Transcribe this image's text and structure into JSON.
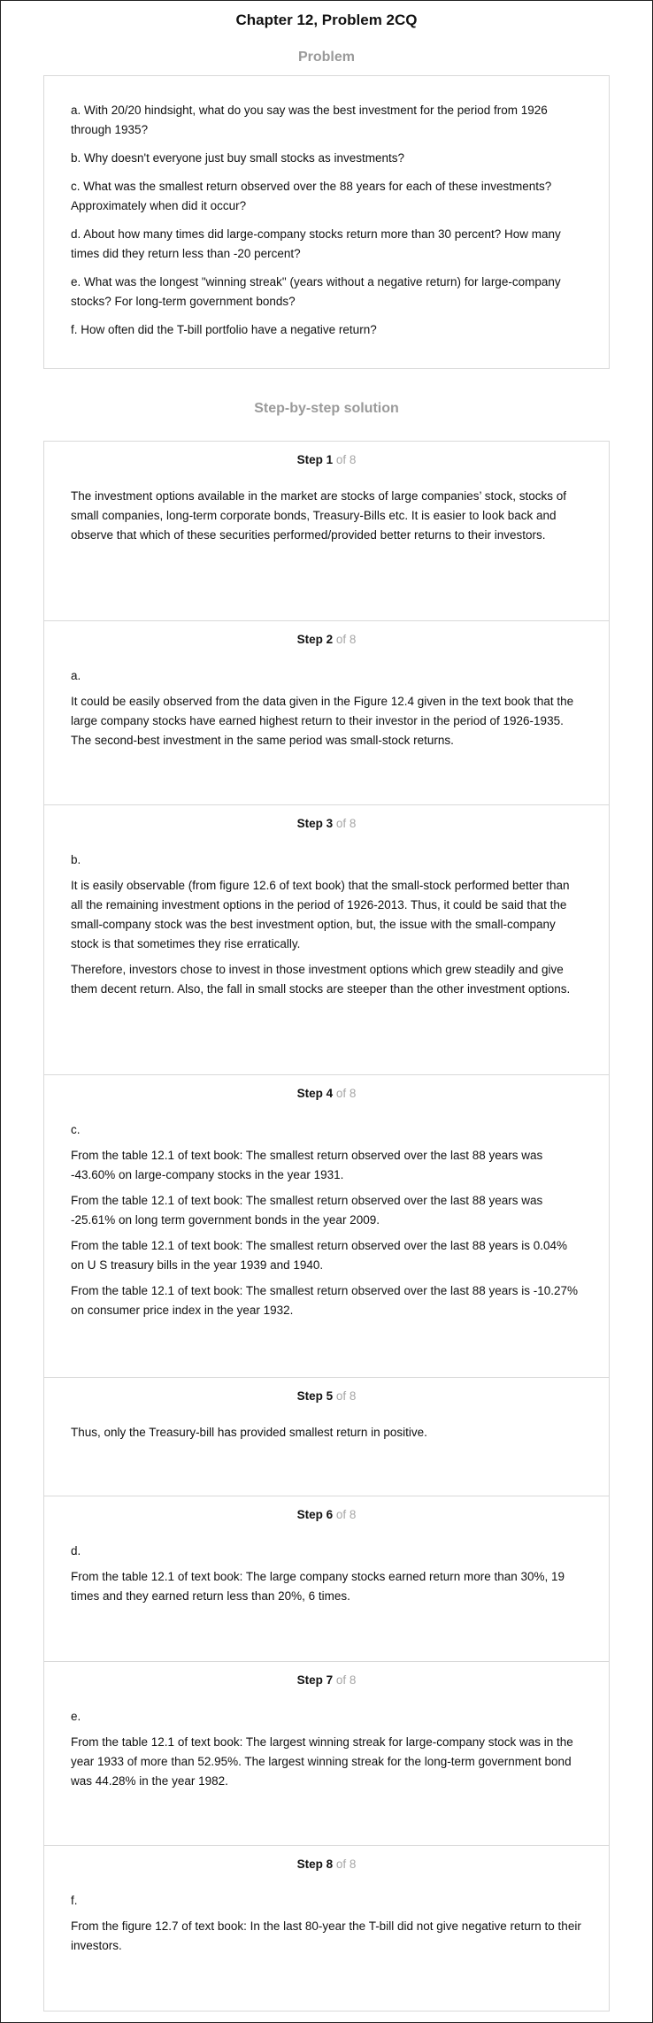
{
  "chapter_title": "Chapter 12, Problem 2CQ",
  "problem": {
    "heading": "Problem",
    "items": [
      "a. With 20/20 hindsight, what do you say was the best investment for the period from 1926 through 1935?",
      "b. Why doesn't everyone just buy small stocks as investments?",
      "c. What was the smallest return observed over the 88 years for each of these investments? Approximately when did it occur?",
      "d. About how many times did large-company stocks return more than 30 percent? How many times did they return less than -20 percent?",
      "e. What was the longest \"winning streak\" (years without a negative return) for large-company stocks? For long-term government bonds?",
      "f. How often did the T-bill portfolio have a negative return?"
    ]
  },
  "solution": {
    "heading": "Step-by-step solution",
    "step_word": "Step",
    "of_prefix": "of",
    "total": "8",
    "steps": [
      {
        "number": "1",
        "paragraphs": [
          "The investment options available in the market are stocks of large companies’ stock, stocks of small companies, long-term corporate bonds, Treasury-Bills etc. It is easier to look back and observe that which of these securities performed/provided better returns to their investors."
        ]
      },
      {
        "number": "2",
        "paragraphs": [
          "a.",
          "It could be easily observed from the data given in the Figure 12.4 given in the text book that the large company stocks have earned highest return to their investor in the period of 1926-1935. The second-best investment in the same period was small-stock returns."
        ]
      },
      {
        "number": "3",
        "paragraphs": [
          "b.",
          "It is easily observable (from figure 12.6 of text book) that the small-stock performed better than all the remaining investment options in the period of 1926-2013. Thus, it could be said that the small-company stock was the best investment option, but, the issue with the small-company stock is that sometimes they rise erratically.",
          "Therefore, investors chose to invest in those investment options which grew steadily and give them decent return. Also, the fall in small stocks are steeper than the other investment options."
        ]
      },
      {
        "number": "4",
        "paragraphs": [
          "c.",
          "From the table 12.1 of text book: The smallest return observed over the last 88 years was -43.60% on large-company stocks in the year 1931.",
          "From the table 12.1 of text book: The smallest return observed over the last 88 years was -25.61% on long term government bonds in the year 2009.",
          "From the table 12.1 of text book: The smallest return observed over the last 88 years is 0.04% on U S treasury bills in the year 1939 and 1940.",
          "From the table 12.1 of text book: The smallest return observed over the last 88 years is -10.27% on consumer price index in the year 1932."
        ]
      },
      {
        "number": "5",
        "paragraphs": [
          "Thus, only the Treasury-bill has provided smallest return in positive."
        ]
      },
      {
        "number": "6",
        "paragraphs": [
          "d.",
          "From the table 12.1 of text book: The large company stocks earned return more than 30%, 19 times and they earned return less than 20%, 6 times."
        ]
      },
      {
        "number": "7",
        "paragraphs": [
          "e.",
          "From the table 12.1 of text book: The largest winning streak for large-company stock was in the year 1933 of more than 52.95%. The largest winning streak for the long-term government bond was 44.28% in the year 1982."
        ]
      },
      {
        "number": "8",
        "paragraphs": [
          "f.",
          "From the figure 12.7 of text book: In the last 80-year the T-bill did not give negative return to their investors."
        ]
      }
    ]
  }
}
